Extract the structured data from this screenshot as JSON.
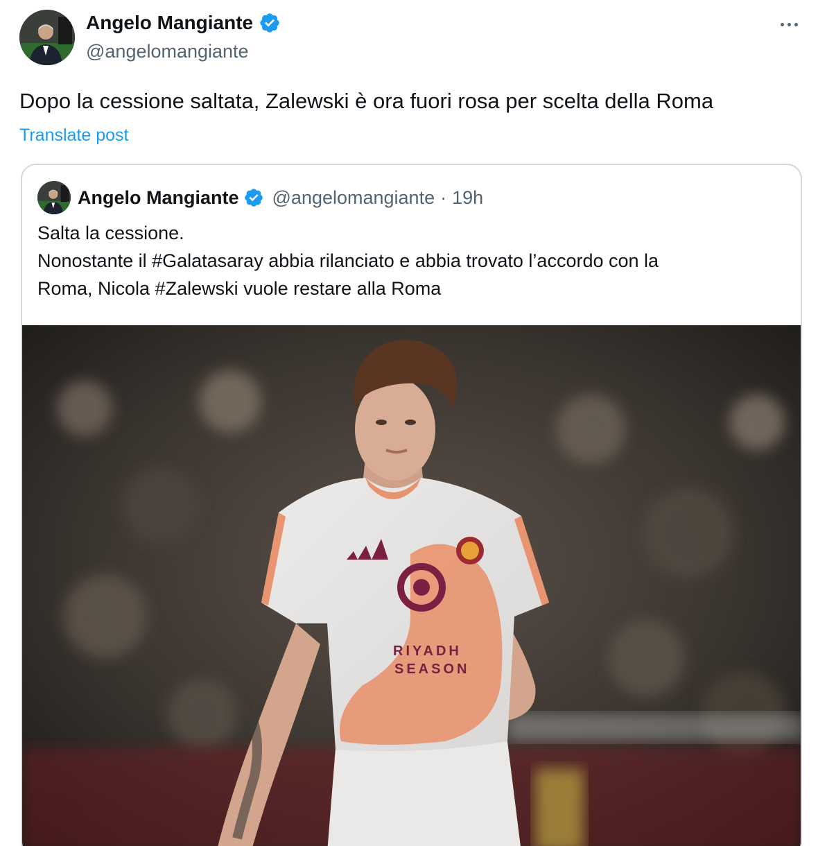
{
  "author": {
    "name": "Angelo Mangiante",
    "handle": "@angelomangiante",
    "verified": true,
    "avatar_icon": "avatar-photo"
  },
  "post": {
    "text": "Dopo la cessione saltata, Zalewski è ora fuori rosa per scelta della Roma",
    "translate_label": "Translate post",
    "more_icon": "more-dots-icon"
  },
  "quoted_post": {
    "author_name": "Angelo Mangiante",
    "handle": "@angelomangiante",
    "separator": "·",
    "time": "19h",
    "lines": [
      "Salta la cessione.",
      "Nonostante il #Galatasaray abbia rilanciato e abbia  trovato l’accordo con la",
      "Roma, Nicola #Zalewski vuole restare alla Roma"
    ],
    "image": {
      "icon": "photo-football-player",
      "jersey_text_line1": "RIYADH",
      "jersey_text_line2": "SEASON"
    }
  },
  "colors": {
    "link": "#1d9bf0",
    "secondary_text": "#536471",
    "border": "#cfd9de",
    "verified": "#1d9bf0"
  }
}
